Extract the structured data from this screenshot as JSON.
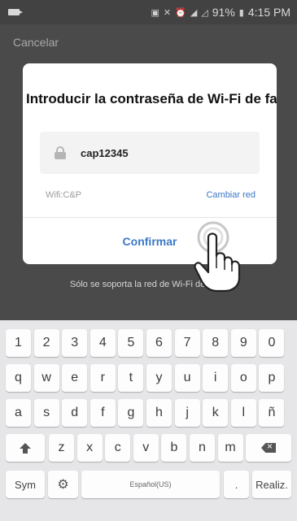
{
  "status_bar": {
    "battery": "91%",
    "time": "4:15 PM",
    "icons": [
      "media-notification-icon",
      "nfc-icon",
      "mute-icon",
      "alarm-icon",
      "wifi-icon",
      "signal-icon",
      "battery-icon"
    ]
  },
  "header": {
    "cancel_label": "Cancelar"
  },
  "dialog": {
    "title": "Introducir la contraseña de Wi-Fi de fa...",
    "password_value": "cap12345",
    "wifi_label": "Wifi:C&P",
    "change_network_label": "Cambiar red",
    "confirm_label": "Confirmar"
  },
  "footer": {
    "note": "Sólo se soporta la red de Wi-Fi de 2,4G"
  },
  "keyboard": {
    "numbers": [
      "1",
      "2",
      "3",
      "4",
      "5",
      "6",
      "7",
      "8",
      "9",
      "0"
    ],
    "row1": [
      "q",
      "w",
      "e",
      "r",
      "t",
      "y",
      "u",
      "i",
      "o",
      "p"
    ],
    "row2": [
      "a",
      "s",
      "d",
      "f",
      "g",
      "h",
      "j",
      "k",
      "l",
      "ñ"
    ],
    "row3": [
      "z",
      "x",
      "c",
      "v",
      "b",
      "n",
      "m"
    ],
    "sym_label": "Sym",
    "space_label": "Español(US)",
    "period_label": ".",
    "enter_label": "Realiz.",
    "icons": [
      "shift-icon",
      "backspace-icon",
      "settings-icon"
    ]
  },
  "colors": {
    "accent": "#3a78c8",
    "overlay": "#4a4a4a",
    "keyboard_bg": "#e6e6e8"
  }
}
